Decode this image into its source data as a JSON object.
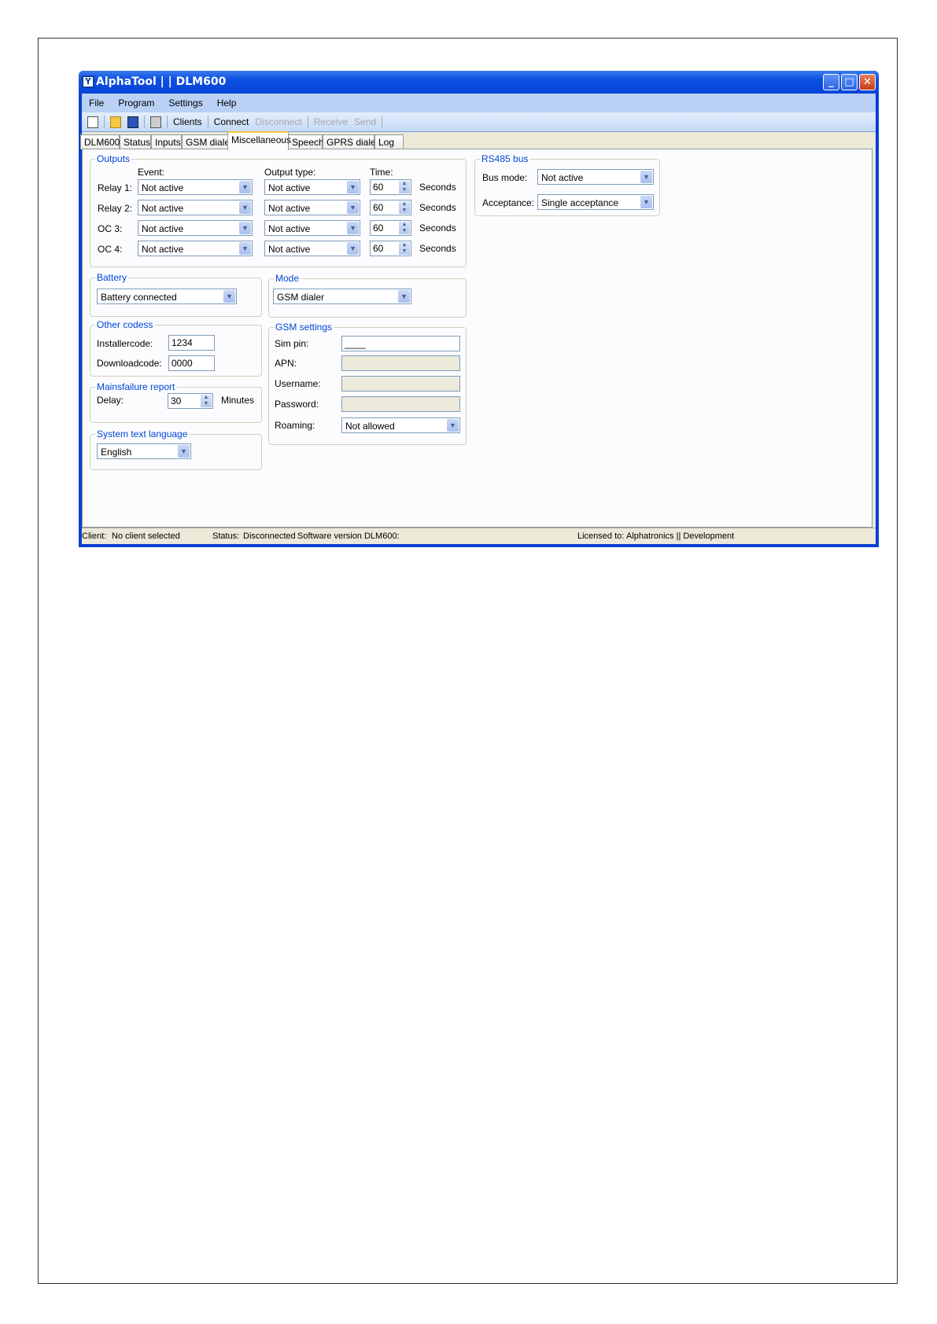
{
  "window": {
    "title": "AlphaTool | | DLM600",
    "controls": [
      "minimize",
      "maximize",
      "close"
    ]
  },
  "menu": [
    "File",
    "Program",
    "Settings",
    "Help"
  ],
  "toolbar": {
    "icons": [
      "new-file-icon",
      "open-folder-icon",
      "save-icon",
      "print-icon"
    ],
    "clients": "Clients",
    "connect": "Connect",
    "disconnect": "Disconnect",
    "receive": "Receive",
    "send": "Send"
  },
  "tabs": [
    "DLM600",
    "Status",
    "Inputs",
    "GSM dialer",
    "Miscellaneous",
    "Speech",
    "GPRS dialer",
    "Log"
  ],
  "active_tab": "Miscellaneous",
  "outputs": {
    "legend": "Outputs",
    "event_header": "Event:",
    "type_header": "Output type:",
    "time_header": "Time:",
    "rows": [
      {
        "label": "Relay 1:",
        "event": "Not active",
        "type": "Not active",
        "time": "60",
        "unit": "Seconds"
      },
      {
        "label": "Relay 2:",
        "event": "Not active",
        "type": "Not active",
        "time": "60",
        "unit": "Seconds"
      },
      {
        "label": "OC 3:",
        "event": "Not active",
        "type": "Not active",
        "time": "60",
        "unit": "Seconds"
      },
      {
        "label": "OC 4:",
        "event": "Not active",
        "type": "Not active",
        "time": "60",
        "unit": "Seconds"
      }
    ]
  },
  "battery": {
    "legend": "Battery",
    "value": "Battery connected"
  },
  "mode": {
    "legend": "Mode",
    "value": "GSM dialer"
  },
  "other_codes": {
    "legend": "Other codess",
    "installer_label": "Installercode:",
    "installer_value": "1234",
    "download_label": "Downloadcode:",
    "download_value": "0000"
  },
  "mainsfailure": {
    "legend": "Mainsfailure report",
    "delay_label": "Delay:",
    "delay_value": "30",
    "unit": "Minutes"
  },
  "language": {
    "legend": "System text language",
    "value": "English"
  },
  "gsm": {
    "legend": "GSM settings",
    "simpin_label": "Sim pin:",
    "simpin_value": "____",
    "apn_label": "APN:",
    "username_label": "Username:",
    "password_label": "Password:",
    "roaming_label": "Roaming:",
    "roaming_value": "Not allowed"
  },
  "rs485": {
    "legend": "RS485 bus",
    "busmode_label": "Bus mode:",
    "busmode_value": "Not active",
    "acceptance_label": "Acceptance:",
    "acceptance_value": "Single acceptance"
  },
  "status": {
    "client_label": "Client:",
    "client_value": "No client selected",
    "status_label": "Status:",
    "status_value": "Disconnected",
    "version": "Software version DLM600:",
    "licensed_label": "Licensed to:",
    "licensed_value": "Alphatronics || Development"
  }
}
